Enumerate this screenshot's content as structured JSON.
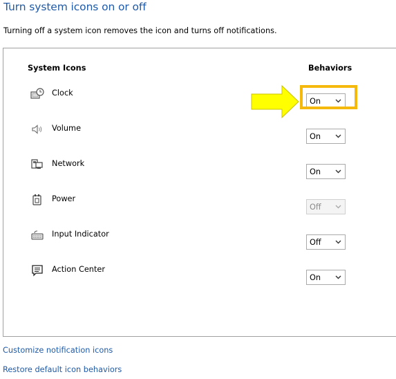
{
  "header": {
    "title": "Turn system icons on or off",
    "subtitle": "Turning off a system icon removes the icon and turns off notifications."
  },
  "table": {
    "col_icons": "System Icons",
    "col_behaviors": "Behaviors",
    "rows": [
      {
        "label": "Clock",
        "icon": "clock-icon",
        "behavior": "On",
        "enabled": true
      },
      {
        "label": "Volume",
        "icon": "volume-icon",
        "behavior": "On",
        "enabled": true
      },
      {
        "label": "Network",
        "icon": "network-icon",
        "behavior": "On",
        "enabled": true
      },
      {
        "label": "Power",
        "icon": "power-icon",
        "behavior": "Off",
        "enabled": false
      },
      {
        "label": "Input Indicator",
        "icon": "keyboard-icon",
        "behavior": "Off",
        "enabled": true
      },
      {
        "label": "Action Center",
        "icon": "action-center-icon",
        "behavior": "On",
        "enabled": true
      }
    ]
  },
  "annotation": {
    "highlight_color": "#f5b90d",
    "arrow_color": "#ffff00"
  },
  "links": {
    "customize": "Customize notification icons",
    "restore": "Restore default icon behaviors"
  },
  "colors": {
    "link": "#1e5aa8",
    "border": "#a0a0a0"
  }
}
